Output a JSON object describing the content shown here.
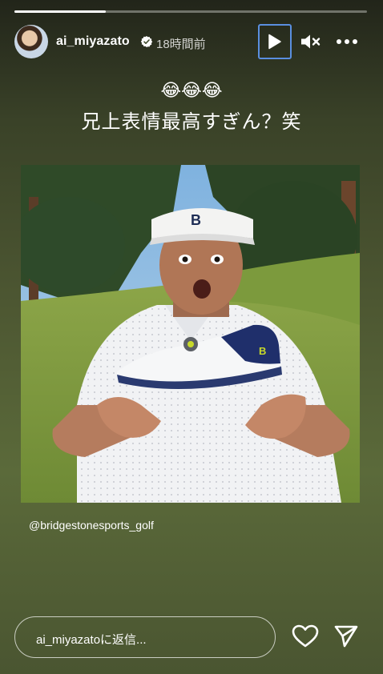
{
  "story": {
    "progress": 0.26,
    "username": "ai_miyazato",
    "time": "18時間前",
    "emojis": "😂😂😂",
    "caption": "兄上表情最高すぎん？笑",
    "mention": "@bridgestonesports_golf"
  },
  "photo_contents": {
    "visor_logo": "B",
    "shoe_logo": "B"
  },
  "reply": {
    "placeholder": "ai_miyazatoに返信..."
  },
  "icons": [
    "verified-badge-icon",
    "play-icon",
    "muted-speaker-icon",
    "more-icon",
    "heart-icon",
    "send-icon"
  ]
}
